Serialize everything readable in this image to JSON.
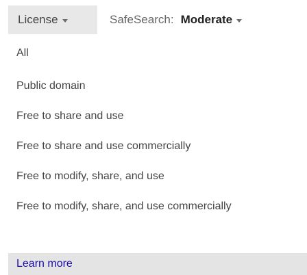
{
  "toolbar": {
    "license_label": "License",
    "safesearch_label": "SafeSearch:",
    "safesearch_value": "Moderate"
  },
  "menu": {
    "items": [
      {
        "label": "All"
      },
      {
        "label": "Public domain"
      },
      {
        "label": "Free to share and use"
      },
      {
        "label": "Free to share and use commercially"
      },
      {
        "label": "Free to modify, share, and use"
      },
      {
        "label": "Free to modify, share, and use commercially"
      }
    ],
    "learn_more": "Learn more"
  },
  "colors": {
    "tab_background": "#e8e8e8",
    "text": "#444444",
    "link": "#1a0dab",
    "highlight": "#e4e4e4"
  }
}
